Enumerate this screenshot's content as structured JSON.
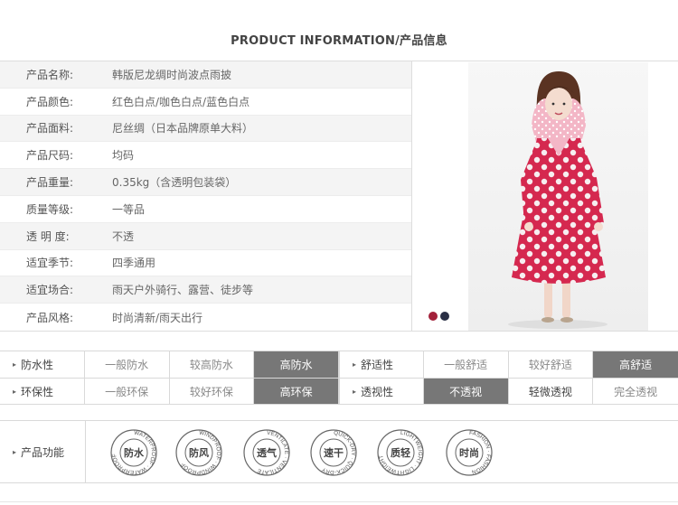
{
  "header": {
    "title": "PRODUCT INFORMATION/产品信息"
  },
  "info": {
    "rows": [
      {
        "key": "产品名称:",
        "value": "韩版尼龙绸时尚波点雨披"
      },
      {
        "key": "产品颜色:",
        "value": "红色白点/咖色白点/蓝色白点"
      },
      {
        "key": "产品面料:",
        "value": "尼丝绸（日本品牌原单大料）"
      },
      {
        "key": "产品尺码:",
        "value": "均码"
      },
      {
        "key": "产品重量:",
        "value": "0.35kg（含透明包装袋）"
      },
      {
        "key": "质量等级:",
        "value": "一等品"
      },
      {
        "key": "透 明 度:",
        "value": "不透"
      },
      {
        "key": "适宜季节:",
        "value": "四季通用"
      },
      {
        "key": "适宜场合:",
        "value": "雨天户外骑行、露营、徒步等"
      },
      {
        "key": "产品风格:",
        "value": "时尚清新/雨天出行"
      }
    ],
    "swatches": [
      "#a3213a",
      "#2a2f45"
    ]
  },
  "attributes": {
    "rows": [
      {
        "left": {
          "label": "防水性",
          "options": [
            "一般防水",
            "较高防水",
            "高防水"
          ],
          "selected": 2
        },
        "right": {
          "label": "舒适性",
          "options": [
            "一般舒适",
            "较好舒适",
            "高舒适"
          ],
          "selected": 2
        }
      },
      {
        "left": {
          "label": "环保性",
          "options": [
            "一般环保",
            "较好环保",
            "高环保"
          ],
          "selected": 2
        },
        "right": {
          "label": "透视性",
          "options": [
            "不透视",
            "轻微透视",
            "完全透视"
          ],
          "selected": 0
        }
      }
    ]
  },
  "features": {
    "label": "产品功能",
    "badges": [
      {
        "center": "防水",
        "ring": "WATERPROOF"
      },
      {
        "center": "防风",
        "ring": "WINDPROOF"
      },
      {
        "center": "透气",
        "ring": "VENTILATE"
      },
      {
        "center": "速干",
        "ring": "QUICK-DRY"
      },
      {
        "center": "质轻",
        "ring": "LIGHTWEIGHT"
      },
      {
        "center": "时尚",
        "ring": "FASHION"
      }
    ]
  },
  "colors": {
    "raincoat": "#d5284f",
    "selected_bg": "#777777",
    "border": "#d9d9d9"
  }
}
